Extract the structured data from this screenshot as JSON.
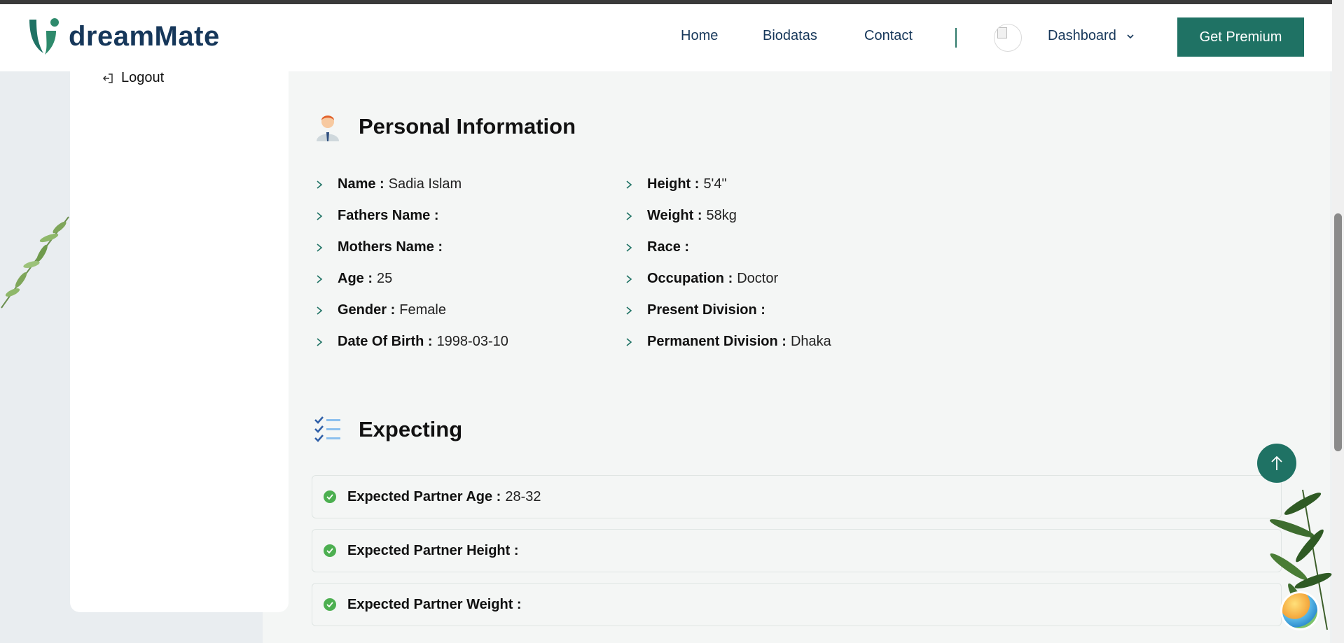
{
  "header": {
    "logo_text": "dreamMate",
    "nav": [
      "Home",
      "Biodatas",
      "Contact"
    ],
    "dashboard_label": "Dashboard",
    "premium_label": "Get Premium"
  },
  "sidebar": {
    "logout_label": "Logout"
  },
  "personal": {
    "title": "Personal Information",
    "left": [
      {
        "key": "Name :",
        "value": "Sadia Islam"
      },
      {
        "key": "Fathers Name :",
        "value": ""
      },
      {
        "key": "Mothers Name :",
        "value": ""
      },
      {
        "key": "Age :",
        "value": "25"
      },
      {
        "key": "Gender :",
        "value": "Female"
      },
      {
        "key": "Date Of Birth :",
        "value": "1998-03-10"
      }
    ],
    "right": [
      {
        "key": "Height :",
        "value": "5'4\""
      },
      {
        "key": "Weight :",
        "value": "58kg"
      },
      {
        "key": "Race :",
        "value": ""
      },
      {
        "key": "Occupation :",
        "value": "Doctor"
      },
      {
        "key": "Present Division :",
        "value": ""
      },
      {
        "key": "Permanent Division :",
        "value": "Dhaka"
      }
    ]
  },
  "expecting": {
    "title": "Expecting",
    "items": [
      {
        "key": "Expected Partner Age :",
        "value": "28-32"
      },
      {
        "key": "Expected Partner Height :",
        "value": ""
      },
      {
        "key": "Expected Partner Weight :",
        "value": ""
      }
    ]
  },
  "colors": {
    "brand": "#1f7264",
    "navy": "#16375a",
    "check": "#4caf50"
  }
}
